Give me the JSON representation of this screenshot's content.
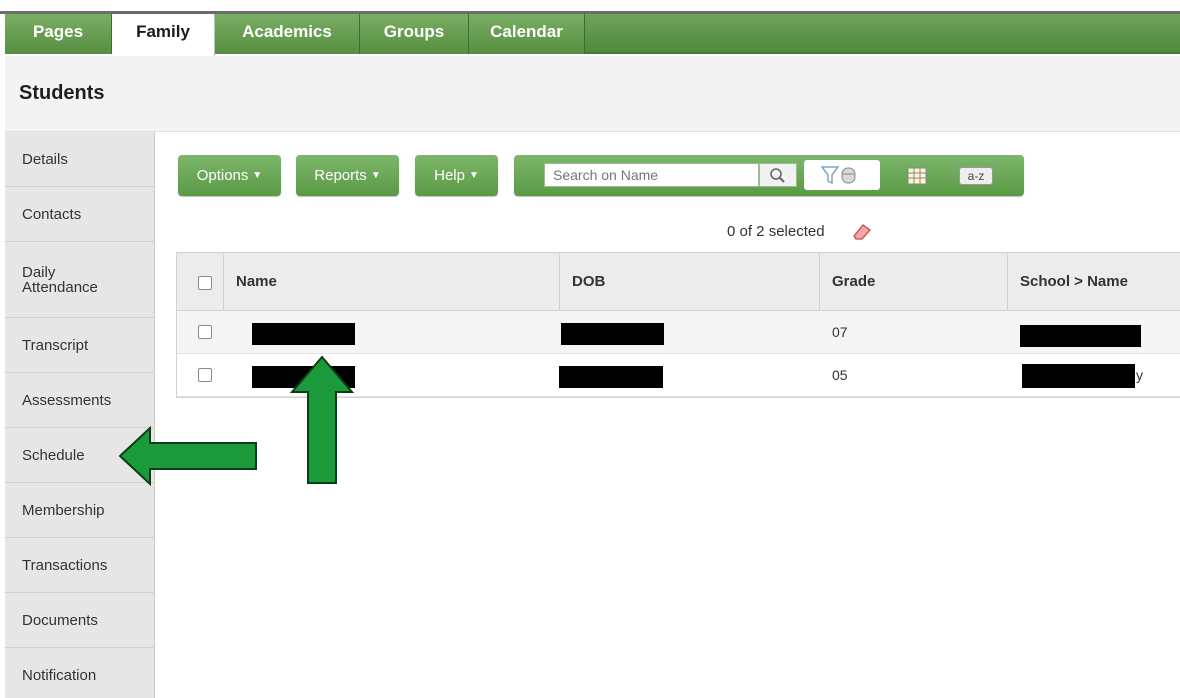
{
  "tabs": [
    {
      "label": "Pages",
      "active": false
    },
    {
      "label": "Family",
      "active": true
    },
    {
      "label": "Academics",
      "active": false
    },
    {
      "label": "Groups",
      "active": false
    },
    {
      "label": "Calendar",
      "active": false
    }
  ],
  "page_title": "Students",
  "sidenav": {
    "items": [
      {
        "label": "Details"
      },
      {
        "label": "Contacts"
      },
      {
        "label": "Daily Attendance"
      },
      {
        "label": "Transcript"
      },
      {
        "label": "Assessments"
      },
      {
        "label": "Schedule"
      },
      {
        "label": "Membership"
      },
      {
        "label": "Transactions"
      },
      {
        "label": "Documents"
      },
      {
        "label": "Notification"
      }
    ]
  },
  "toolbar": {
    "options_label": "Options",
    "reports_label": "Reports",
    "help_label": "Help",
    "caret": "▼",
    "search_placeholder": "Search on Name",
    "az_label": "a-z"
  },
  "selection": {
    "text": "0 of 2 selected"
  },
  "table": {
    "columns": [
      "Name",
      "DOB",
      "Grade",
      "School > Name"
    ],
    "rows": [
      {
        "name": "[redacted]",
        "dob": "[redacted]",
        "grade": "07",
        "school": "[redacted]"
      },
      {
        "name": "[redacted]",
        "dob": "[redacted]",
        "grade": "05",
        "school": "[redacted]"
      }
    ],
    "school_suffix_row2": "y"
  },
  "colors": {
    "tab_green": "#5a9a46",
    "annotation_arrow": "#1a9a3a",
    "redaction": "#000000"
  },
  "icons": {
    "search": "magnifier-icon",
    "filter": "funnel-filter-icon",
    "columns": "grid-columns-icon",
    "clear": "eraser-icon"
  }
}
